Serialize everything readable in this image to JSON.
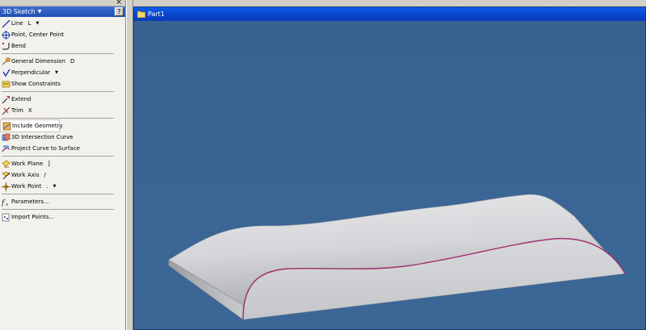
{
  "panel": {
    "close_glyph": "×",
    "title": "3D Sketch",
    "help_glyph": "?",
    "tools": [
      {
        "icon": "line-icon",
        "label": "Line",
        "key": "L",
        "caret": true
      },
      {
        "icon": "center-point-icon",
        "label": "Point, Center Point",
        "key": "",
        "caret": false
      },
      {
        "icon": "bend-icon",
        "label": "Bend",
        "key": "",
        "caret": false
      },
      {
        "sep": true
      },
      {
        "icon": "general-dimension-icon",
        "label": "General Dimension",
        "key": "D",
        "caret": false
      },
      {
        "icon": "perpendicular-icon",
        "label": "Perpendicular",
        "key": "",
        "caret": true
      },
      {
        "icon": "show-constraints-icon",
        "label": "Show Constraints",
        "key": "",
        "caret": false
      },
      {
        "sep": true
      },
      {
        "icon": "extend-icon",
        "label": "Extend",
        "key": "",
        "caret": false
      },
      {
        "icon": "trim-icon",
        "label": "Trim",
        "key": "X",
        "caret": false
      },
      {
        "sep": true
      },
      {
        "icon": "include-geometry-icon",
        "label": "Include Geometry",
        "key": "",
        "caret": false,
        "selected": true
      },
      {
        "icon": "intersection-curve-icon",
        "label": "3D Intersection Curve",
        "key": "",
        "caret": false
      },
      {
        "icon": "project-curve-icon",
        "label": "Project Curve to Surface",
        "key": "",
        "caret": false
      },
      {
        "sep": true
      },
      {
        "icon": "work-plane-icon",
        "label": "Work Plane",
        "key": "]",
        "caret": false
      },
      {
        "icon": "work-axis-icon",
        "label": "Work Axis",
        "key": "/",
        "caret": false
      },
      {
        "icon": "work-point-icon",
        "label": "Work Point",
        "key": ".",
        "caret": true
      },
      {
        "sep": true
      },
      {
        "icon": "parameters-icon",
        "label": "Parameters...",
        "key": "",
        "caret": false
      },
      {
        "sep": true
      },
      {
        "icon": "import-points-icon",
        "label": "Import Points...",
        "key": "",
        "caret": false
      }
    ]
  },
  "document": {
    "title": "Part1",
    "icon": "part-icon"
  },
  "colors": {
    "viewport_bg": "#3a6594",
    "curve": "#a0306e",
    "header": "#2a5bc0",
    "doc_titlebar": "#0a4fd8"
  }
}
